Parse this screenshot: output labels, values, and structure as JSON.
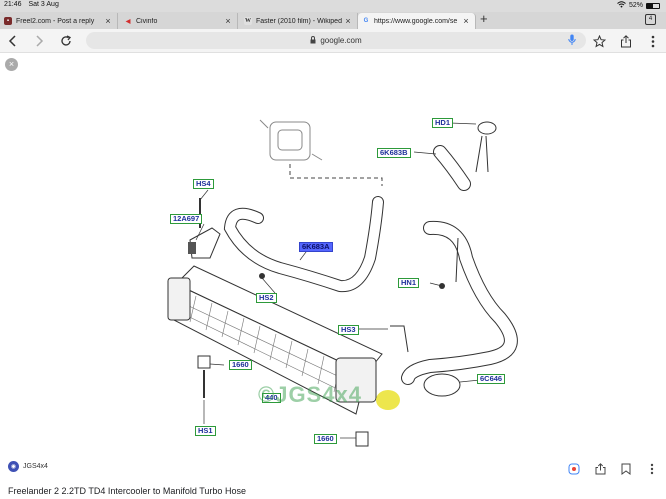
{
  "status": {
    "time": "21:46",
    "date": "Sat 3 Aug",
    "battery": "52%",
    "battery_level": 0.52
  },
  "tabs": [
    {
      "title": "Freel2.com - Post a reply",
      "favicon": "freel2-icon"
    },
    {
      "title": "Civinfo",
      "favicon": "civinfo-icon"
    },
    {
      "title": "Faster (2010 film) - Wikiped",
      "favicon": "wikipedia-icon"
    },
    {
      "title": "https://www.google.com/se",
      "favicon": "google-icon"
    }
  ],
  "tab_count": "4",
  "address": {
    "url": "google.com"
  },
  "diagram": {
    "labels": {
      "hd1": "HD1",
      "k683b": "6K683B",
      "hs4": "HS4",
      "a697": "12A697",
      "k683a": "6K683A",
      "hn1": "HN1",
      "hs2": "HS2",
      "hs3": "HS3",
      "c646": "6C646",
      "n1660a": "1660",
      "n440": "440",
      "hs1": "HS1",
      "n1660b": "1660"
    },
    "watermark": "©JGS4x4"
  },
  "result": {
    "source": "JGS4x4",
    "caption": "Freelander 2 2.2TD TD4 Intercooler to Manifold Turbo Hose"
  }
}
